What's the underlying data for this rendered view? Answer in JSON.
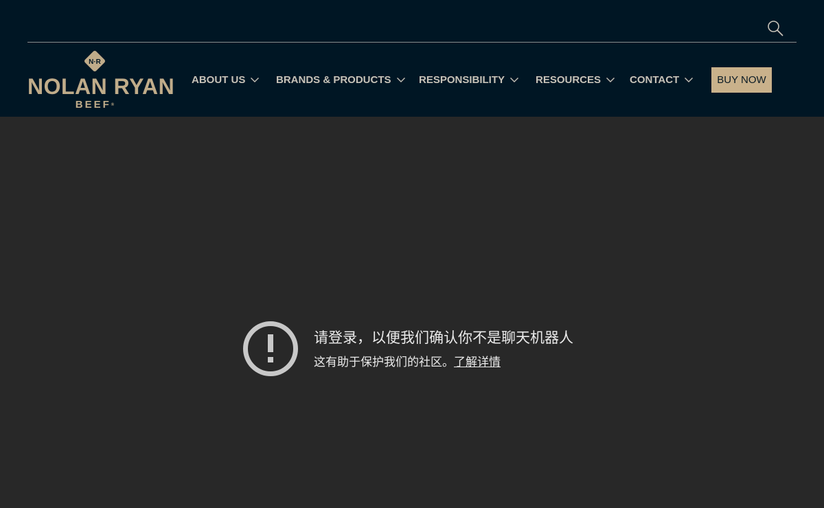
{
  "header": {
    "search_icon": "search-icon",
    "logo": {
      "badge_text": "N·R",
      "name": "NOLAN RYAN",
      "subtitle": "BEEF",
      "mark": "®"
    },
    "nav": [
      {
        "label": "ABOUT US",
        "icon": "chevron-down-icon"
      },
      {
        "label": "BRANDS & PRODUCTS",
        "icon": "chevron-down-icon"
      },
      {
        "label": "RESPONSIBILITY",
        "icon": "chevron-down-icon"
      },
      {
        "label": "RESOURCES",
        "icon": "chevron-down-icon"
      },
      {
        "label": "CONTACT",
        "icon": "chevron-down-icon"
      }
    ],
    "buy_now": "BUY NOW"
  },
  "notice": {
    "icon": "exclamation-circle-icon",
    "title": "请登录，以便我们确认你不是聊天机器人",
    "body": "这有助于保护我们的社区。",
    "link": "了解详情"
  },
  "colors": {
    "header_bg": "#001624",
    "body_bg": "#282828",
    "brand_tan": "#c9b18b",
    "nav_text": "#c7c2b8"
  }
}
